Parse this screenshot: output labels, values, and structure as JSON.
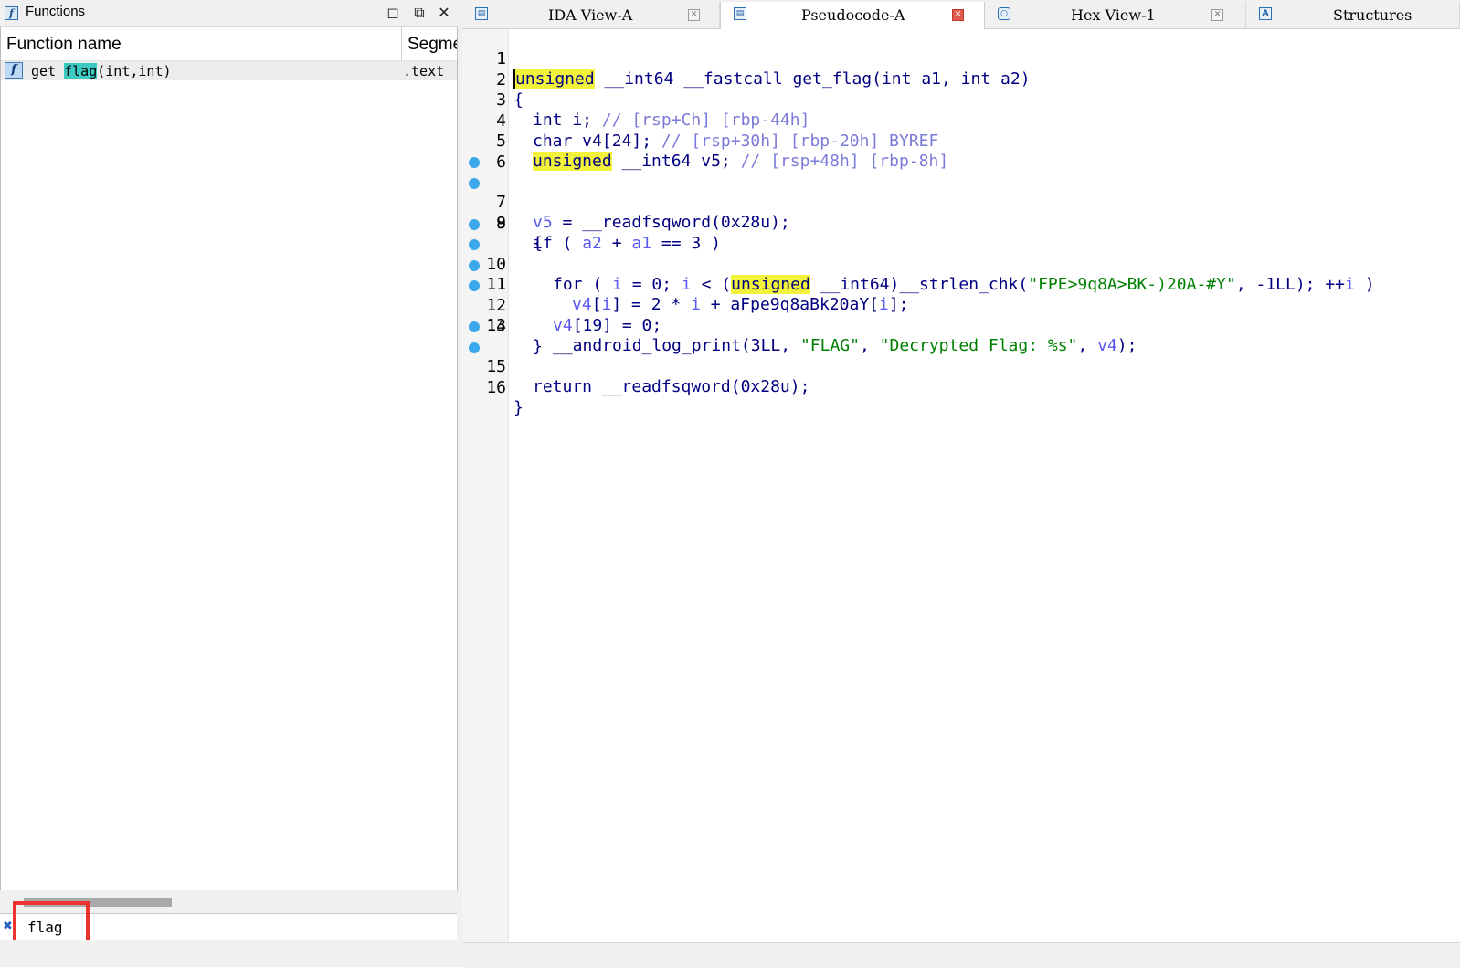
{
  "functions_panel": {
    "title": "Functions",
    "icon": "function-icon",
    "window_buttons": [
      "maximize-icon",
      "restore-icon",
      "close-icon"
    ],
    "columns": {
      "name": "Function name",
      "segment": "Segme"
    },
    "rows": [
      {
        "name_before": "get_",
        "name_match": "flag",
        "name_after": "(int,int)",
        "segment": ".text"
      }
    ],
    "filter": {
      "value": "flag"
    }
  },
  "tabs": [
    {
      "label": "IDA View-A",
      "icon": "ida-view-icon",
      "active": false
    },
    {
      "label": "Pseudocode-A",
      "icon": "pseudocode-icon",
      "active": true
    },
    {
      "label": "Hex View-1",
      "icon": "hex-view-icon",
      "active": false
    },
    {
      "label": "Structures",
      "icon": "structures-icon",
      "active": false
    }
  ],
  "code": {
    "lines": [
      {
        "no": "1",
        "bp": false
      },
      {
        "no": "2",
        "bp": false
      },
      {
        "no": "3",
        "bp": false
      },
      {
        "no": "4",
        "bp": false
      },
      {
        "no": "5",
        "bp": false
      },
      {
        "no": "6",
        "bp": false
      },
      {
        "no": "7",
        "bp": true
      },
      {
        "no": "8",
        "bp": true
      },
      {
        "no": "9",
        "bp": false
      },
      {
        "no": "10",
        "bp": true
      },
      {
        "no": "11",
        "bp": true
      },
      {
        "no": "12",
        "bp": true
      },
      {
        "no": "13",
        "bp": true
      },
      {
        "no": "14",
        "bp": false
      },
      {
        "no": "15",
        "bp": true
      },
      {
        "no": "16",
        "bp": true
      }
    ],
    "t": {
      "l1_kw": "unsigned",
      "l1_rest": " __int64 __fastcall get_flag(int a1, int a2)",
      "open_brace": "{",
      "close_brace": "}",
      "l3_decl": "int i; ",
      "l3_cm": "// [rsp+Ch] [rbp-44h]",
      "l4_decl": "char v4[24]; ",
      "l4_cm": "// [rsp+30h] [rbp-20h] BYREF",
      "l5_kw": "unsigned",
      "l5_decl": " __int64 v5; ",
      "l5_cm": "// [rsp+48h] [rbp-8h]",
      "l7_var": "v5",
      "l7_rest": " = __readfsqword(0x28u);",
      "l8_a": "if ( ",
      "l8_v1": "a2",
      "l8_b": " + ",
      "l8_v2": "a1",
      "l8_c": " == 3 )",
      "l9": "{",
      "l10_a": "for ( ",
      "l10_v1": "i",
      "l10_b": " = 0; ",
      "l10_v2": "i",
      "l10_c": " < (",
      "l10_kw": "unsigned",
      "l10_d": " __int64)__strlen_chk(",
      "l10_str": "\"FPE>9q8A>BK-)20A-#Y\"",
      "l10_e": ", -1LL); ++",
      "l10_v3": "i",
      "l10_f": " )",
      "l11_v1": "v4",
      "l11_a": "[",
      "l11_v2": "i",
      "l11_b": "] = 2 * ",
      "l11_v3": "i",
      "l11_c": " + aFpe9q8aBk20aY[",
      "l11_v4": "i",
      "l11_d": "];",
      "l12_v": "v4",
      "l12_rest": "[19] = 0;",
      "l13_a": "__android_log_print(3LL, ",
      "l13_s1": "\"FLAG\"",
      "l13_b": ", ",
      "l13_s2": "\"Decrypted Flag: %s\"",
      "l13_c": ", ",
      "l13_v": "v4",
      "l13_d": ");",
      "l14": "}",
      "l15": "return __readfsqword(0x28u);"
    }
  }
}
